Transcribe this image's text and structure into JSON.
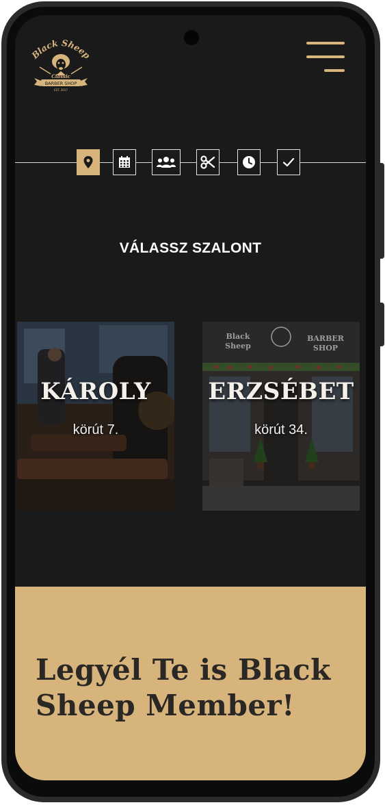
{
  "brand": {
    "name_line1": "Black Sheep",
    "name_line2": "Classic",
    "name_line3": "BARBER SHOP",
    "est": "EST. 2017",
    "gold": "#d6b47c"
  },
  "header": {
    "menu_icon": "hamburger-menu-icon"
  },
  "steps": [
    {
      "icon": "location-pin-icon",
      "active": true
    },
    {
      "icon": "calendar-icon",
      "active": false
    },
    {
      "icon": "people-icon",
      "active": false
    },
    {
      "icon": "scissors-icon",
      "active": false
    },
    {
      "icon": "clock-icon",
      "active": false
    },
    {
      "icon": "checkmark-icon",
      "active": false
    }
  ],
  "section_title": "VÁLASSZ SZALONT",
  "salons": [
    {
      "name": "KÁROLY",
      "address": "körút 7."
    },
    {
      "name": "ERZSÉBET",
      "address": "körút 34.",
      "sign_left": "Black Sheep",
      "sign_right": "BARBER SHOP"
    }
  ],
  "member": {
    "title": "Legyél Te is Black Sheep Member!"
  }
}
